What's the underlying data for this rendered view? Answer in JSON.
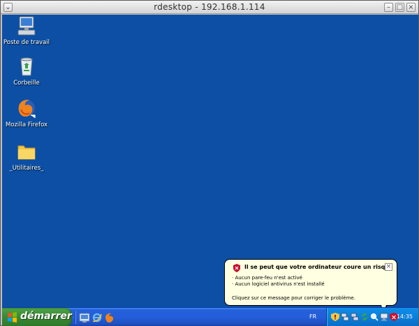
{
  "window": {
    "title": "rdesktop - 192.168.1.114",
    "menu_glyph": "⌄",
    "minimize_glyph": "–",
    "maximize_glyph": "□",
    "close_glyph": "×"
  },
  "desktop": {
    "background": "#0c4fa5",
    "icons": [
      {
        "label": "Poste de travail",
        "icon": "my-computer-icon"
      },
      {
        "label": "Corbeille",
        "icon": "recycle-bin-icon"
      },
      {
        "label": "Mozilla Firefox",
        "icon": "firefox-icon"
      },
      {
        "label": "_Utilitaires_",
        "icon": "folder-icon"
      }
    ]
  },
  "balloon": {
    "title": "Il se peut que votre ordinateur coure un risque",
    "close_glyph": "×",
    "lines": [
      "· Aucun pare-feu n'est activé",
      "· Aucun logiciel antivirus n'est installé"
    ],
    "action": "Cliquez sur ce message pour corriger le problème."
  },
  "taskbar": {
    "start_label": "démarrer",
    "quick_launch": [
      "show-desktop-icon",
      "internet-explorer-icon",
      "firefox-icon"
    ],
    "language": "FR",
    "tray_icons": [
      "security-shield-icon",
      "network-icon",
      "network-icon-2",
      "update-icon",
      "search-icon",
      "display-icon",
      "security-alert-icon"
    ],
    "clock": "14:35"
  }
}
